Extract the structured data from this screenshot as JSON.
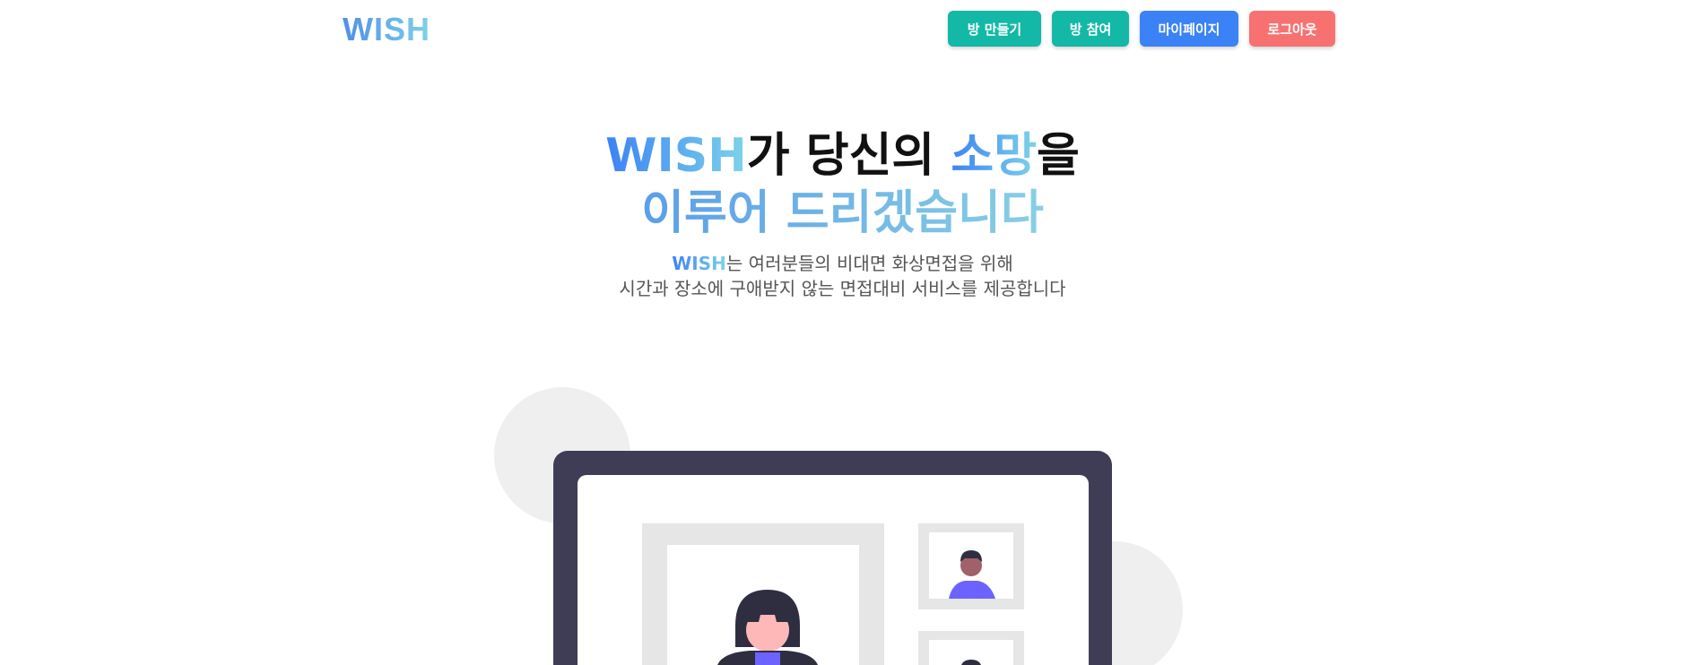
{
  "header": {
    "logo": "WISH",
    "nav": {
      "create_room": "방 만들기",
      "join_room": "방 참여",
      "my_page": "마이페이지",
      "logout": "로그아웃"
    }
  },
  "hero": {
    "headline_brand": "WISH",
    "headline_part1": "가 당신의 ",
    "headline_highlight": "소망",
    "headline_part2": "을",
    "headline_line2": "이루어 드리겠습니다",
    "sub_brand": "WISH",
    "sub_line1_rest": "는 여러분들의 비대면 화상면접을 위해",
    "sub_line2": "시간과 장소에 구애받지 않는 면접대비 서비스를 제공합니다"
  },
  "colors": {
    "teal": "#14b8a6",
    "blue": "#3b82f6",
    "coral": "#f87171",
    "laptop_frame": "#3f3d56",
    "avatar_shirt": "#6c63ff"
  },
  "illustration": {
    "icon": "video-conference-illustration"
  }
}
